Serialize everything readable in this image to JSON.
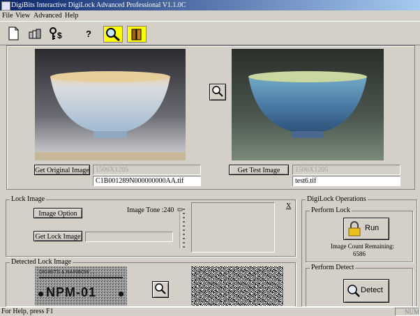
{
  "window": {
    "title": "DigiBits Interactive DigiLock Advanced Professional V1.1.0C"
  },
  "menu": {
    "items": [
      "File",
      "View",
      "Advanced",
      "Help"
    ]
  },
  "toolbar": {
    "icons": [
      "new-document-icon",
      "cards-icon",
      "key-dollar-icon",
      "help-question-icon",
      "magnifier-icon",
      "book-icon"
    ]
  },
  "images": {
    "original": {
      "button": "Get Original Image",
      "dims": "1506X1205",
      "filename": "C1B001289N000000000AA.tif"
    },
    "test": {
      "button": "Get Test Image",
      "dims": "1506X1205",
      "filename": "test6.tif"
    }
  },
  "lock_image": {
    "group_label": "Lock Image",
    "option_button": "Image Option",
    "tone_label": "Image Tone :240",
    "get_button": "Get Lock Image",
    "close_mark": "X"
  },
  "detected": {
    "group_label": "Detected Lock Image",
    "logo_line1": "DIGIBITS & RAINBOW ...",
    "logo_main": "NPM-01"
  },
  "operations": {
    "group_label": "DigiLock Operations",
    "perform_lock": "Perform Lock",
    "run_button": "Run",
    "remaining_label": "Image Count Remaining:",
    "remaining_value": "6586",
    "perform_detect": "Perform Detect",
    "detect_button": "Detect"
  },
  "status": {
    "help": "For Help, press F1",
    "num": "NUM"
  },
  "colors": {
    "titlebar": "#0a246a",
    "face": "#d4d0c8",
    "lock_yellow": "#e8c020"
  }
}
